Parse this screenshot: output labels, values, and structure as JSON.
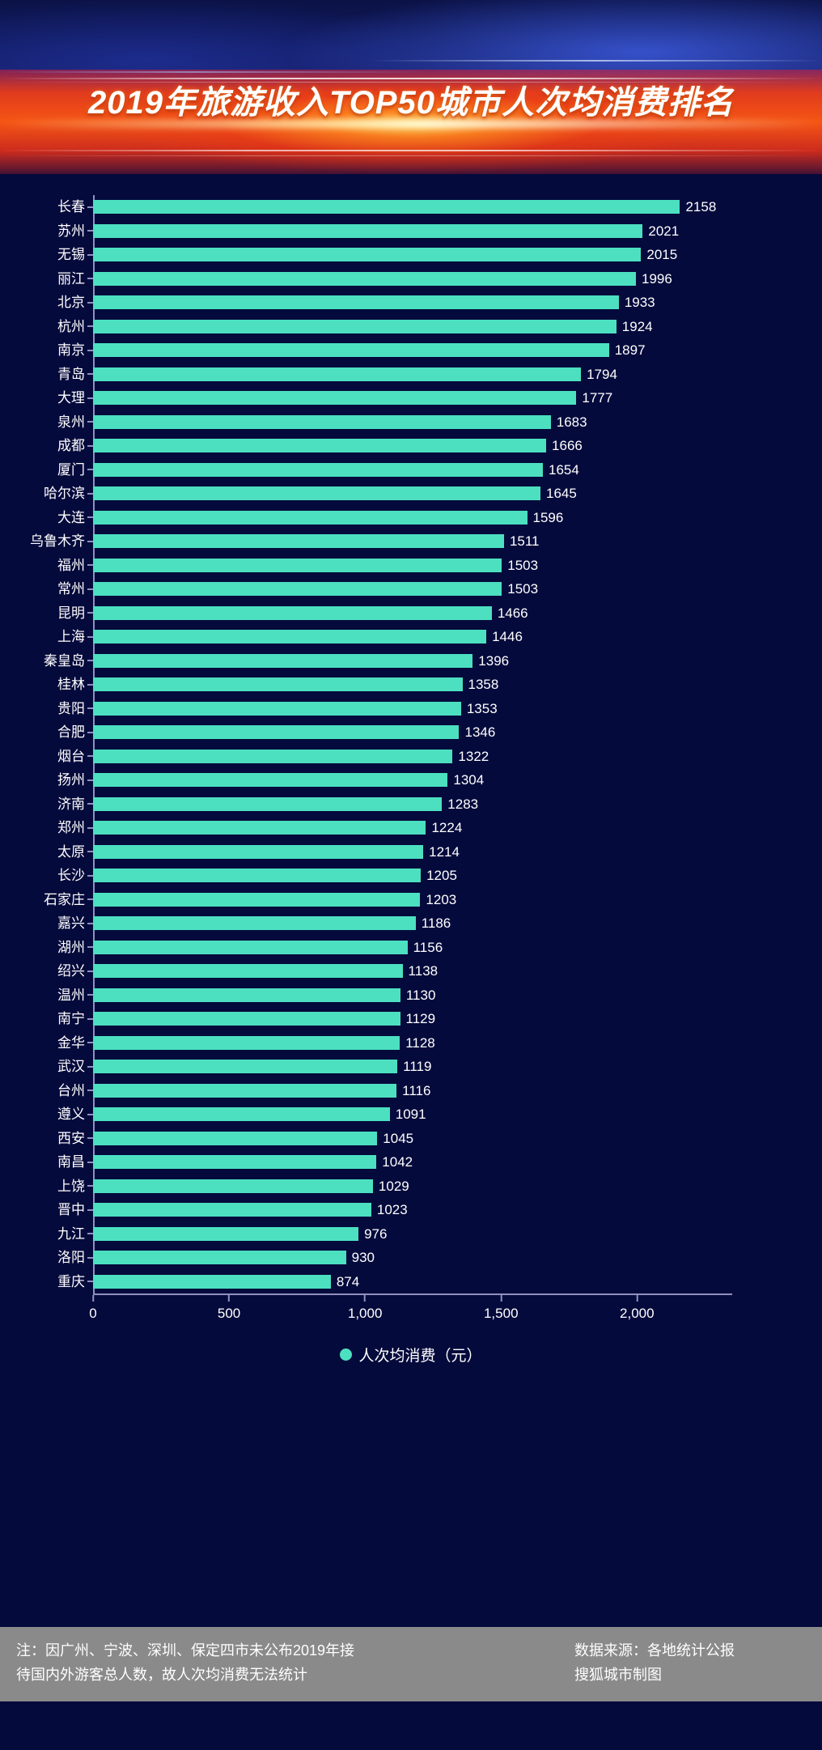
{
  "header": {
    "title": "2019年旅游收入TOP50城市人次均消费排名"
  },
  "legend": {
    "label": "人次均消费（元）",
    "color": "#4ce0c0"
  },
  "axis": {
    "ticks": [
      "0",
      "500",
      "1,000",
      "1,500",
      "2,000"
    ],
    "tick_values": [
      0,
      500,
      1000,
      1500,
      2000
    ],
    "max": 2350
  },
  "footer": {
    "note_line1": "注：因广州、宁波、深圳、保定四市未公布2019年接",
    "note_line2": "待国内外游客总人数，故人次均消费无法统计",
    "source_line1": "数据来源：各地统计公报",
    "source_line2": "搜狐城市制图"
  },
  "colors": {
    "background": "#050a3c",
    "bar": "#4ce0c0",
    "axis": "#8f90c0",
    "footer_bg": "#8a8a8a"
  },
  "chart_data": {
    "type": "bar",
    "orientation": "horizontal",
    "title": "2019年旅游收入TOP50城市人次均消费排名",
    "xlabel": "",
    "ylabel": "",
    "xlim": [
      0,
      2350
    ],
    "grid": false,
    "legend_position": "bottom-center",
    "legend_entries": [
      "人次均消费（元）"
    ],
    "series_name": "人次均消费（元）",
    "unit": "元",
    "categories": [
      "长春",
      "苏州",
      "无锡",
      "丽江",
      "北京",
      "杭州",
      "南京",
      "青岛",
      "大理",
      "泉州",
      "成都",
      "厦门",
      "哈尔滨",
      "大连",
      "乌鲁木齐",
      "福州",
      "常州",
      "昆明",
      "上海",
      "秦皇岛",
      "桂林",
      "贵阳",
      "合肥",
      "烟台",
      "扬州",
      "济南",
      "郑州",
      "太原",
      "长沙",
      "石家庄",
      "嘉兴",
      "湖州",
      "绍兴",
      "温州",
      "南宁",
      "金华",
      "武汉",
      "台州",
      "遵义",
      "西安",
      "南昌",
      "上饶",
      "晋中",
      "九江",
      "洛阳",
      "重庆"
    ],
    "values": [
      2158,
      2021,
      2015,
      1996,
      1933,
      1924,
      1897,
      1794,
      1777,
      1683,
      1666,
      1654,
      1645,
      1596,
      1511,
      1503,
      1503,
      1466,
      1446,
      1396,
      1358,
      1353,
      1346,
      1322,
      1304,
      1283,
      1224,
      1214,
      1205,
      1203,
      1186,
      1156,
      1138,
      1130,
      1129,
      1128,
      1119,
      1116,
      1091,
      1045,
      1042,
      1029,
      1023,
      976,
      930,
      874
    ]
  }
}
